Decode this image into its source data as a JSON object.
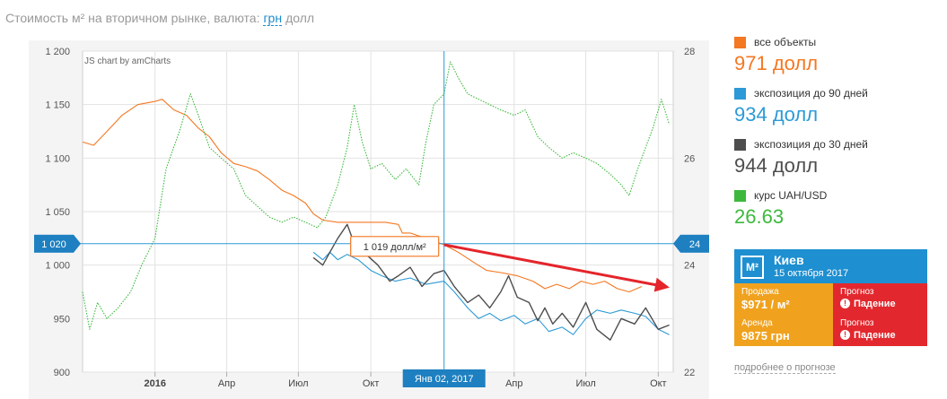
{
  "header": {
    "title": "Стоимость м² на вторичном рынке, валюта:",
    "currency_active": "грн",
    "currency_other": "долл"
  },
  "legend": [
    {
      "name": "все объекты",
      "value": "971 долл",
      "color": "#f47721"
    },
    {
      "name": "экспозиция до 90 дней",
      "value": "934 долл",
      "color": "#2c9ad7"
    },
    {
      "name": "экспозиция до 30 дней",
      "value": "944 долл",
      "color": "#4d4d4d"
    },
    {
      "name": "курс UAH/USD",
      "value": "26.63",
      "color": "#3cb93c"
    }
  ],
  "forecast": {
    "city": "Киев",
    "date": "15 октября 2017",
    "sale_label": "Продажа",
    "sale_value": "$971 / м²",
    "rent_label": "Аренда",
    "rent_value": "9875 грн",
    "forecast_label": "Прогноз",
    "forecast_value": "Падение",
    "logo": "М²",
    "more_link": "подробнее о прогнозе"
  },
  "chart_data": {
    "type": "line",
    "watermark": "JS chart by amCharts",
    "x_range": [
      "2015-10-01",
      "2017-10-20"
    ],
    "x_ticks": [
      {
        "date": "2016-01-01",
        "label": "2016"
      },
      {
        "date": "2016-04-01",
        "label": "Апр"
      },
      {
        "date": "2016-07-01",
        "label": "Июл"
      },
      {
        "date": "2016-10-01",
        "label": "Окт"
      },
      {
        "date": "2017-04-01",
        "label": "Апр"
      },
      {
        "date": "2017-07-01",
        "label": "Июл"
      },
      {
        "date": "2017-10-01",
        "label": "Окт"
      }
    ],
    "y_left": {
      "min": 900,
      "max": 1200,
      "ticks": [
        900,
        950,
        1000,
        1050,
        1100,
        1150,
        1200
      ],
      "tick_labels": [
        "900",
        "950",
        "1 000",
        "1 050",
        "1 100",
        "1 150",
        "1 200"
      ]
    },
    "y_right": {
      "min": 22,
      "max": 28,
      "ticks": [
        22,
        24,
        26,
        28
      ],
      "tick_labels": [
        "22",
        "24",
        "26",
        "28"
      ]
    },
    "cursor": {
      "date": "2017-01-02",
      "label": "Янв 02, 2017",
      "y_left": 1020,
      "y_left_label": "1 020",
      "y_right": 24,
      "y_right_label": "24"
    },
    "balloon": "1 019 долл/м²",
    "annotation": {
      "type": "arrow",
      "color": "#e4252b",
      "from": [
        "2017-01-02",
        1019
      ],
      "to": [
        "2017-10-20",
        980
      ]
    },
    "grid": true,
    "series": [
      {
        "name": "все объекты",
        "axis": "left",
        "color": "#f47721",
        "points": [
          [
            "2015-10-01",
            1115
          ],
          [
            "2015-10-15",
            1112
          ],
          [
            "2015-11-01",
            1125
          ],
          [
            "2015-11-20",
            1140
          ],
          [
            "2015-12-10",
            1150
          ],
          [
            "2016-01-01",
            1153
          ],
          [
            "2016-01-10",
            1155
          ],
          [
            "2016-01-25",
            1145
          ],
          [
            "2016-02-10",
            1140
          ],
          [
            "2016-02-25",
            1128
          ],
          [
            "2016-03-10",
            1120
          ],
          [
            "2016-03-25",
            1105
          ],
          [
            "2016-04-10",
            1095
          ],
          [
            "2016-04-25",
            1092
          ],
          [
            "2016-05-10",
            1088
          ],
          [
            "2016-05-25",
            1080
          ],
          [
            "2016-06-10",
            1070
          ],
          [
            "2016-06-25",
            1065
          ],
          [
            "2016-07-10",
            1058
          ],
          [
            "2016-07-20",
            1048
          ],
          [
            "2016-08-01",
            1042
          ],
          [
            "2016-08-20",
            1040
          ],
          [
            "2016-09-10",
            1040
          ],
          [
            "2016-10-01",
            1040
          ],
          [
            "2016-10-20",
            1040
          ],
          [
            "2016-11-05",
            1038
          ],
          [
            "2016-11-10",
            1030
          ],
          [
            "2016-11-20",
            1030
          ],
          [
            "2016-12-10",
            1025
          ],
          [
            "2017-01-02",
            1019
          ],
          [
            "2017-01-20",
            1012
          ],
          [
            "2017-02-10",
            1002
          ],
          [
            "2017-02-25",
            995
          ],
          [
            "2017-03-15",
            993
          ],
          [
            "2017-04-05",
            990
          ],
          [
            "2017-04-25",
            985
          ],
          [
            "2017-05-10",
            978
          ],
          [
            "2017-05-25",
            982
          ],
          [
            "2017-06-10",
            978
          ],
          [
            "2017-06-25",
            985
          ],
          [
            "2017-07-10",
            982
          ],
          [
            "2017-07-25",
            985
          ],
          [
            "2017-08-10",
            978
          ],
          [
            "2017-08-25",
            975
          ],
          [
            "2017-09-10",
            980
          ]
        ]
      },
      {
        "name": "экспозиция до 90 дней",
        "axis": "left",
        "color": "#2c9ad7",
        "points": [
          [
            "2016-07-20",
            1012
          ],
          [
            "2016-08-01",
            1005
          ],
          [
            "2016-08-10",
            1012
          ],
          [
            "2016-08-20",
            1005
          ],
          [
            "2016-09-01",
            1010
          ],
          [
            "2016-09-15",
            1005
          ],
          [
            "2016-10-01",
            995
          ],
          [
            "2016-10-15",
            990
          ],
          [
            "2016-11-01",
            985
          ],
          [
            "2016-11-20",
            988
          ],
          [
            "2016-12-10",
            982
          ],
          [
            "2017-01-02",
            985
          ],
          [
            "2017-01-15",
            975
          ],
          [
            "2017-02-01",
            960
          ],
          [
            "2017-02-15",
            950
          ],
          [
            "2017-03-01",
            955
          ],
          [
            "2017-03-15",
            948
          ],
          [
            "2017-04-01",
            953
          ],
          [
            "2017-04-15",
            945
          ],
          [
            "2017-05-01",
            950
          ],
          [
            "2017-05-15",
            938
          ],
          [
            "2017-06-01",
            942
          ],
          [
            "2017-06-15",
            935
          ],
          [
            "2017-07-01",
            950
          ],
          [
            "2017-07-15",
            958
          ],
          [
            "2017-08-01",
            955
          ],
          [
            "2017-08-15",
            958
          ],
          [
            "2017-09-01",
            955
          ],
          [
            "2017-09-15",
            952
          ],
          [
            "2017-10-01",
            940
          ],
          [
            "2017-10-15",
            935
          ]
        ]
      },
      {
        "name": "экспозиция до 30 дней",
        "axis": "left",
        "color": "#4d4d4d",
        "points": [
          [
            "2016-07-20",
            1007
          ],
          [
            "2016-08-01",
            1000
          ],
          [
            "2016-08-10",
            1012
          ],
          [
            "2016-08-20",
            1025
          ],
          [
            "2016-09-01",
            1038
          ],
          [
            "2016-09-10",
            1020
          ],
          [
            "2016-09-25",
            1010
          ],
          [
            "2016-10-10",
            1000
          ],
          [
            "2016-10-25",
            985
          ],
          [
            "2016-11-05",
            990
          ],
          [
            "2016-11-20",
            998
          ],
          [
            "2016-12-05",
            980
          ],
          [
            "2016-12-20",
            992
          ],
          [
            "2017-01-02",
            995
          ],
          [
            "2017-01-15",
            980
          ],
          [
            "2017-02-01",
            965
          ],
          [
            "2017-02-15",
            972
          ],
          [
            "2017-03-01",
            960
          ],
          [
            "2017-03-15",
            975
          ],
          [
            "2017-03-25",
            990
          ],
          [
            "2017-04-05",
            970
          ],
          [
            "2017-04-20",
            965
          ],
          [
            "2017-05-01",
            948
          ],
          [
            "2017-05-10",
            960
          ],
          [
            "2017-05-20",
            945
          ],
          [
            "2017-06-01",
            955
          ],
          [
            "2017-06-15",
            942
          ],
          [
            "2017-07-01",
            965
          ],
          [
            "2017-07-15",
            940
          ],
          [
            "2017-08-01",
            930
          ],
          [
            "2017-08-15",
            950
          ],
          [
            "2017-09-01",
            945
          ],
          [
            "2017-09-15",
            960
          ],
          [
            "2017-10-01",
            940
          ],
          [
            "2017-10-15",
            944
          ]
        ]
      },
      {
        "name": "курс UAH/USD",
        "axis": "right",
        "color": "#3cb93c",
        "points": [
          [
            "2015-10-01",
            23.5
          ],
          [
            "2015-10-10",
            22.8
          ],
          [
            "2015-10-20",
            23.3
          ],
          [
            "2015-11-01",
            23.0
          ],
          [
            "2015-11-15",
            23.2
          ],
          [
            "2015-12-01",
            23.5
          ],
          [
            "2015-12-15",
            24.0
          ],
          [
            "2016-01-01",
            24.5
          ],
          [
            "2016-01-15",
            25.8
          ],
          [
            "2016-02-01",
            26.5
          ],
          [
            "2016-02-15",
            27.2
          ],
          [
            "2016-02-25",
            26.8
          ],
          [
            "2016-03-10",
            26.2
          ],
          [
            "2016-03-25",
            26.0
          ],
          [
            "2016-04-10",
            25.8
          ],
          [
            "2016-04-25",
            25.3
          ],
          [
            "2016-05-10",
            25.1
          ],
          [
            "2016-05-25",
            24.9
          ],
          [
            "2016-06-10",
            24.8
          ],
          [
            "2016-06-25",
            24.9
          ],
          [
            "2016-07-10",
            24.8
          ],
          [
            "2016-07-25",
            24.7
          ],
          [
            "2016-08-05",
            24.9
          ],
          [
            "2016-08-20",
            25.5
          ],
          [
            "2016-09-01",
            26.2
          ],
          [
            "2016-09-10",
            27.0
          ],
          [
            "2016-09-20",
            26.3
          ],
          [
            "2016-10-01",
            25.8
          ],
          [
            "2016-10-15",
            25.9
          ],
          [
            "2016-11-01",
            25.6
          ],
          [
            "2016-11-15",
            25.8
          ],
          [
            "2016-12-01",
            25.5
          ],
          [
            "2016-12-10",
            26.3
          ],
          [
            "2016-12-20",
            27.0
          ],
          [
            "2017-01-02",
            27.2
          ],
          [
            "2017-01-10",
            27.8
          ],
          [
            "2017-01-20",
            27.5
          ],
          [
            "2017-02-01",
            27.2
          ],
          [
            "2017-02-15",
            27.1
          ],
          [
            "2017-03-01",
            27.0
          ],
          [
            "2017-03-15",
            26.9
          ],
          [
            "2017-04-01",
            26.8
          ],
          [
            "2017-04-15",
            26.9
          ],
          [
            "2017-05-01",
            26.4
          ],
          [
            "2017-05-15",
            26.2
          ],
          [
            "2017-06-01",
            26.0
          ],
          [
            "2017-06-15",
            26.1
          ],
          [
            "2017-07-01",
            26.0
          ],
          [
            "2017-07-15",
            25.9
          ],
          [
            "2017-08-01",
            25.7
          ],
          [
            "2017-08-15",
            25.5
          ],
          [
            "2017-08-25",
            25.3
          ],
          [
            "2017-09-05",
            25.8
          ],
          [
            "2017-09-15",
            26.2
          ],
          [
            "2017-09-25",
            26.6
          ],
          [
            "2017-10-05",
            27.1
          ],
          [
            "2017-10-15",
            26.63
          ]
        ]
      }
    ]
  }
}
